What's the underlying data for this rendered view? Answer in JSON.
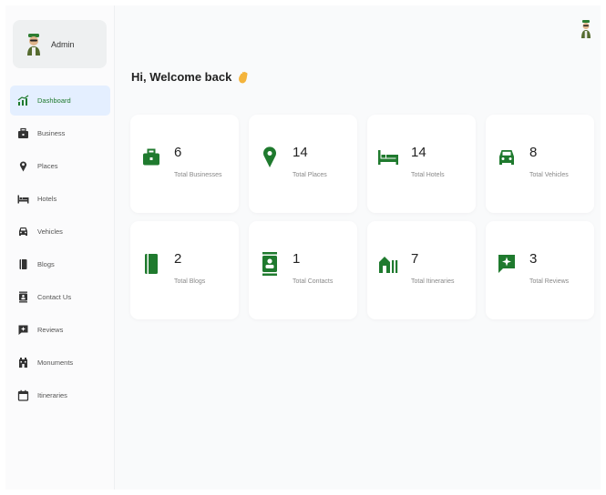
{
  "user": {
    "name": "Admin"
  },
  "nav": [
    {
      "label": "Dashboard",
      "icon": "chart-icon",
      "active": true
    },
    {
      "label": "Business",
      "icon": "briefcase-icon"
    },
    {
      "label": "Places",
      "icon": "map-pin-icon"
    },
    {
      "label": "Hotels",
      "icon": "bed-icon"
    },
    {
      "label": "Vehicles",
      "icon": "car-icon"
    },
    {
      "label": "Blogs",
      "icon": "book-icon"
    },
    {
      "label": "Contact Us",
      "icon": "contact-icon"
    },
    {
      "label": "Reviews",
      "icon": "review-icon"
    },
    {
      "label": "Monuments",
      "icon": "monument-icon"
    },
    {
      "label": "Itineraries",
      "icon": "calendar-icon"
    }
  ],
  "header": {
    "welcome": "Hi, Welcome back"
  },
  "stats": [
    {
      "value": "6",
      "label": "Total Businesses",
      "icon": "briefcase-icon"
    },
    {
      "value": "14",
      "label": "Total Places",
      "icon": "map-pin-icon"
    },
    {
      "value": "14",
      "label": "Total Hotels",
      "icon": "bed-icon"
    },
    {
      "value": "8",
      "label": "Total Vehicles",
      "icon": "car-icon"
    },
    {
      "value": "2",
      "label": "Total Blogs",
      "icon": "book-icon"
    },
    {
      "value": "1",
      "label": "Total Contacts",
      "icon": "contact-icon"
    },
    {
      "value": "7",
      "label": "Total Itineraries",
      "icon": "itinerary-icon"
    },
    {
      "value": "3",
      "label": "Total Reviews",
      "icon": "review-icon"
    }
  ],
  "colors": {
    "accent": "#1f7a2e",
    "active_bg": "#e4efff",
    "card_bg": "#ffffff",
    "page_bg": "#f9fafb"
  }
}
